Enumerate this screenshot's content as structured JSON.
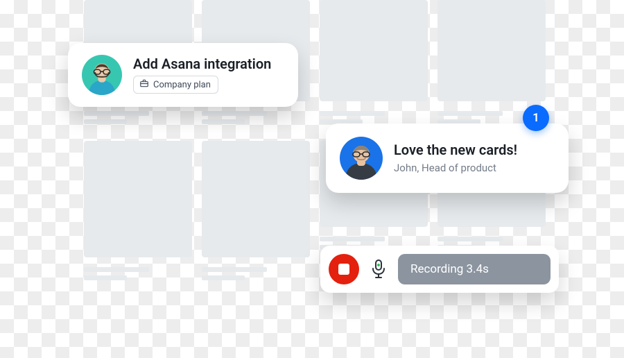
{
  "bubble1": {
    "title": "Add Asana integration",
    "tag_label": "Company plan"
  },
  "bubble2": {
    "title": "Love the new cards!",
    "subtitle": "John, Head of product"
  },
  "badge": {
    "count": "1"
  },
  "recording": {
    "label": "Recording 3.4s"
  },
  "colors": {
    "badge_bg": "#0a6bff",
    "stop_bg": "#e4200e",
    "avatar1_bg": "#37c7b1",
    "avatar2_bg": "#1a73e8",
    "recpill_bg": "#8b949f"
  }
}
